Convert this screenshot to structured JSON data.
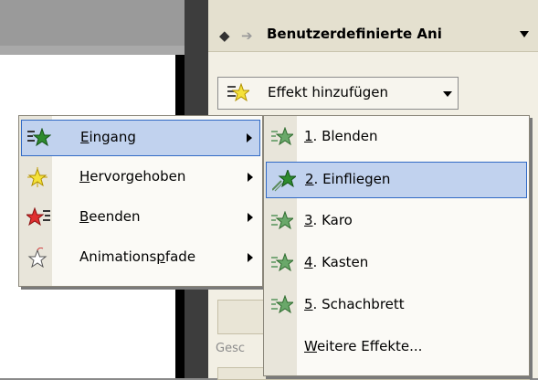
{
  "pane": {
    "title": "Benutzerdefinierte Ani",
    "add_effect_label": "Effekt hinzufügen",
    "label_gesc": "Gesc"
  },
  "menu": {
    "items": [
      {
        "label": "Eingang",
        "mnemonic": "E",
        "rest": "ingang",
        "icon": "entrance-star-icon",
        "selected": true
      },
      {
        "label": "Hervorgehoben",
        "mnemonic": "H",
        "rest": "ervorgehoben",
        "icon": "emphasis-star-icon",
        "selected": false
      },
      {
        "label": "Beenden",
        "mnemonic": "B",
        "rest": "eenden",
        "icon": "exit-star-icon",
        "selected": false
      },
      {
        "label": "Animationspfade",
        "pre": "Animations",
        "mnemonic": "p",
        "rest": "fade",
        "icon": "motion-path-star-icon",
        "selected": false
      }
    ]
  },
  "submenu": {
    "items": [
      {
        "label": "1. Blenden",
        "mnemonic": "1",
        "rest": ". Blenden",
        "selected": false
      },
      {
        "label": "2. Einfliegen",
        "mnemonic": "2",
        "rest": ". Einfliegen",
        "selected": true
      },
      {
        "label": "3. Karo",
        "mnemonic": "3",
        "rest": ". Karo",
        "selected": false
      },
      {
        "label": "4. Kasten",
        "mnemonic": "4",
        "rest": ". Kasten",
        "selected": false
      },
      {
        "label": "5. Schachbrett",
        "mnemonic": "5",
        "rest": ". Schachbrett",
        "selected": false
      },
      {
        "label": "Weitere Effekte...",
        "mnemonic": "W",
        "rest": "eitere Effekte...",
        "selected": false
      }
    ]
  },
  "colors": {
    "selection_bg": "#c1d2ee",
    "selection_border": "#316ac5",
    "entrance_green": "#2e8b2e",
    "emphasis_yellow": "#f5e23a",
    "exit_red": "#e03030"
  }
}
